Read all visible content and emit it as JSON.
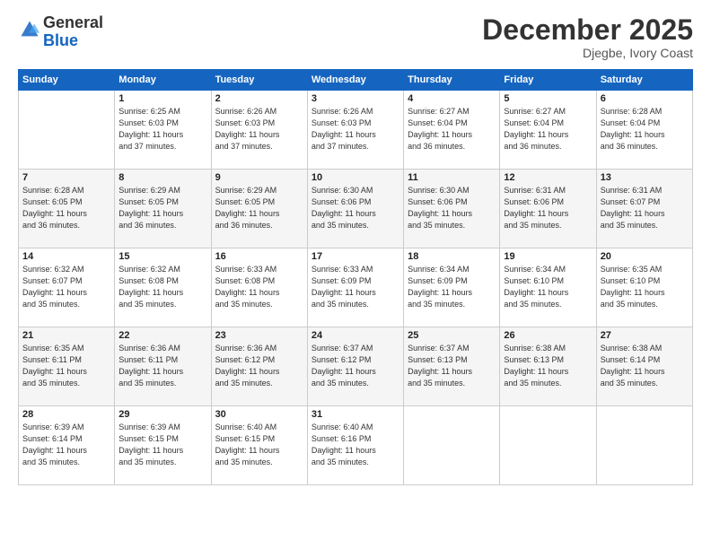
{
  "header": {
    "logo_general": "General",
    "logo_blue": "Blue",
    "month_title": "December 2025",
    "location": "Djegbe, Ivory Coast"
  },
  "days_of_week": [
    "Sunday",
    "Monday",
    "Tuesday",
    "Wednesday",
    "Thursday",
    "Friday",
    "Saturday"
  ],
  "weeks": [
    [
      {
        "day": "",
        "info": ""
      },
      {
        "day": "1",
        "info": "Sunrise: 6:25 AM\nSunset: 6:03 PM\nDaylight: 11 hours\nand 37 minutes."
      },
      {
        "day": "2",
        "info": "Sunrise: 6:26 AM\nSunset: 6:03 PM\nDaylight: 11 hours\nand 37 minutes."
      },
      {
        "day": "3",
        "info": "Sunrise: 6:26 AM\nSunset: 6:03 PM\nDaylight: 11 hours\nand 37 minutes."
      },
      {
        "day": "4",
        "info": "Sunrise: 6:27 AM\nSunset: 6:04 PM\nDaylight: 11 hours\nand 36 minutes."
      },
      {
        "day": "5",
        "info": "Sunrise: 6:27 AM\nSunset: 6:04 PM\nDaylight: 11 hours\nand 36 minutes."
      },
      {
        "day": "6",
        "info": "Sunrise: 6:28 AM\nSunset: 6:04 PM\nDaylight: 11 hours\nand 36 minutes."
      }
    ],
    [
      {
        "day": "7",
        "info": "Sunrise: 6:28 AM\nSunset: 6:05 PM\nDaylight: 11 hours\nand 36 minutes."
      },
      {
        "day": "8",
        "info": "Sunrise: 6:29 AM\nSunset: 6:05 PM\nDaylight: 11 hours\nand 36 minutes."
      },
      {
        "day": "9",
        "info": "Sunrise: 6:29 AM\nSunset: 6:05 PM\nDaylight: 11 hours\nand 36 minutes."
      },
      {
        "day": "10",
        "info": "Sunrise: 6:30 AM\nSunset: 6:06 PM\nDaylight: 11 hours\nand 35 minutes."
      },
      {
        "day": "11",
        "info": "Sunrise: 6:30 AM\nSunset: 6:06 PM\nDaylight: 11 hours\nand 35 minutes."
      },
      {
        "day": "12",
        "info": "Sunrise: 6:31 AM\nSunset: 6:06 PM\nDaylight: 11 hours\nand 35 minutes."
      },
      {
        "day": "13",
        "info": "Sunrise: 6:31 AM\nSunset: 6:07 PM\nDaylight: 11 hours\nand 35 minutes."
      }
    ],
    [
      {
        "day": "14",
        "info": "Sunrise: 6:32 AM\nSunset: 6:07 PM\nDaylight: 11 hours\nand 35 minutes."
      },
      {
        "day": "15",
        "info": "Sunrise: 6:32 AM\nSunset: 6:08 PM\nDaylight: 11 hours\nand 35 minutes."
      },
      {
        "day": "16",
        "info": "Sunrise: 6:33 AM\nSunset: 6:08 PM\nDaylight: 11 hours\nand 35 minutes."
      },
      {
        "day": "17",
        "info": "Sunrise: 6:33 AM\nSunset: 6:09 PM\nDaylight: 11 hours\nand 35 minutes."
      },
      {
        "day": "18",
        "info": "Sunrise: 6:34 AM\nSunset: 6:09 PM\nDaylight: 11 hours\nand 35 minutes."
      },
      {
        "day": "19",
        "info": "Sunrise: 6:34 AM\nSunset: 6:10 PM\nDaylight: 11 hours\nand 35 minutes."
      },
      {
        "day": "20",
        "info": "Sunrise: 6:35 AM\nSunset: 6:10 PM\nDaylight: 11 hours\nand 35 minutes."
      }
    ],
    [
      {
        "day": "21",
        "info": "Sunrise: 6:35 AM\nSunset: 6:11 PM\nDaylight: 11 hours\nand 35 minutes."
      },
      {
        "day": "22",
        "info": "Sunrise: 6:36 AM\nSunset: 6:11 PM\nDaylight: 11 hours\nand 35 minutes."
      },
      {
        "day": "23",
        "info": "Sunrise: 6:36 AM\nSunset: 6:12 PM\nDaylight: 11 hours\nand 35 minutes."
      },
      {
        "day": "24",
        "info": "Sunrise: 6:37 AM\nSunset: 6:12 PM\nDaylight: 11 hours\nand 35 minutes."
      },
      {
        "day": "25",
        "info": "Sunrise: 6:37 AM\nSunset: 6:13 PM\nDaylight: 11 hours\nand 35 minutes."
      },
      {
        "day": "26",
        "info": "Sunrise: 6:38 AM\nSunset: 6:13 PM\nDaylight: 11 hours\nand 35 minutes."
      },
      {
        "day": "27",
        "info": "Sunrise: 6:38 AM\nSunset: 6:14 PM\nDaylight: 11 hours\nand 35 minutes."
      }
    ],
    [
      {
        "day": "28",
        "info": "Sunrise: 6:39 AM\nSunset: 6:14 PM\nDaylight: 11 hours\nand 35 minutes."
      },
      {
        "day": "29",
        "info": "Sunrise: 6:39 AM\nSunset: 6:15 PM\nDaylight: 11 hours\nand 35 minutes."
      },
      {
        "day": "30",
        "info": "Sunrise: 6:40 AM\nSunset: 6:15 PM\nDaylight: 11 hours\nand 35 minutes."
      },
      {
        "day": "31",
        "info": "Sunrise: 6:40 AM\nSunset: 6:16 PM\nDaylight: 11 hours\nand 35 minutes."
      },
      {
        "day": "",
        "info": ""
      },
      {
        "day": "",
        "info": ""
      },
      {
        "day": "",
        "info": ""
      }
    ]
  ]
}
